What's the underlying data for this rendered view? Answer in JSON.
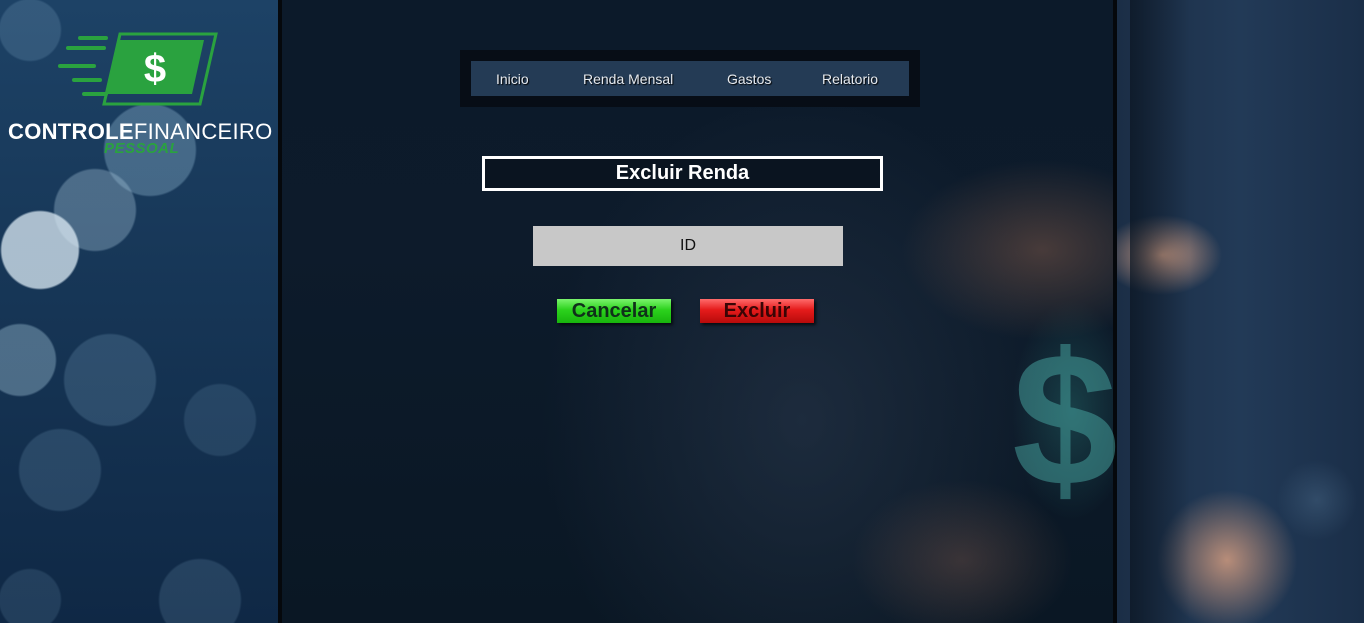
{
  "logo": {
    "word1": "CONTROLE",
    "word2": "FINANCEIRO",
    "subtitle": "PESSOAL",
    "symbol": "$",
    "icon": "money-bill-icon"
  },
  "nav": {
    "items": [
      {
        "label": "Inicio"
      },
      {
        "label": "Renda Mensal"
      },
      {
        "label": "Gastos"
      },
      {
        "label": "Relatorio"
      }
    ]
  },
  "form": {
    "title": "Excluir Renda",
    "id_placeholder": "ID",
    "id_value": ""
  },
  "buttons": {
    "cancel": "Cancelar",
    "delete": "Excluir"
  },
  "colors": {
    "accent_green": "#2cd21d",
    "danger_red": "#e51b1b",
    "nav_bg": "#243b55",
    "brand_green": "#2aa23f"
  },
  "background_icon": "dollar-sign-icon"
}
